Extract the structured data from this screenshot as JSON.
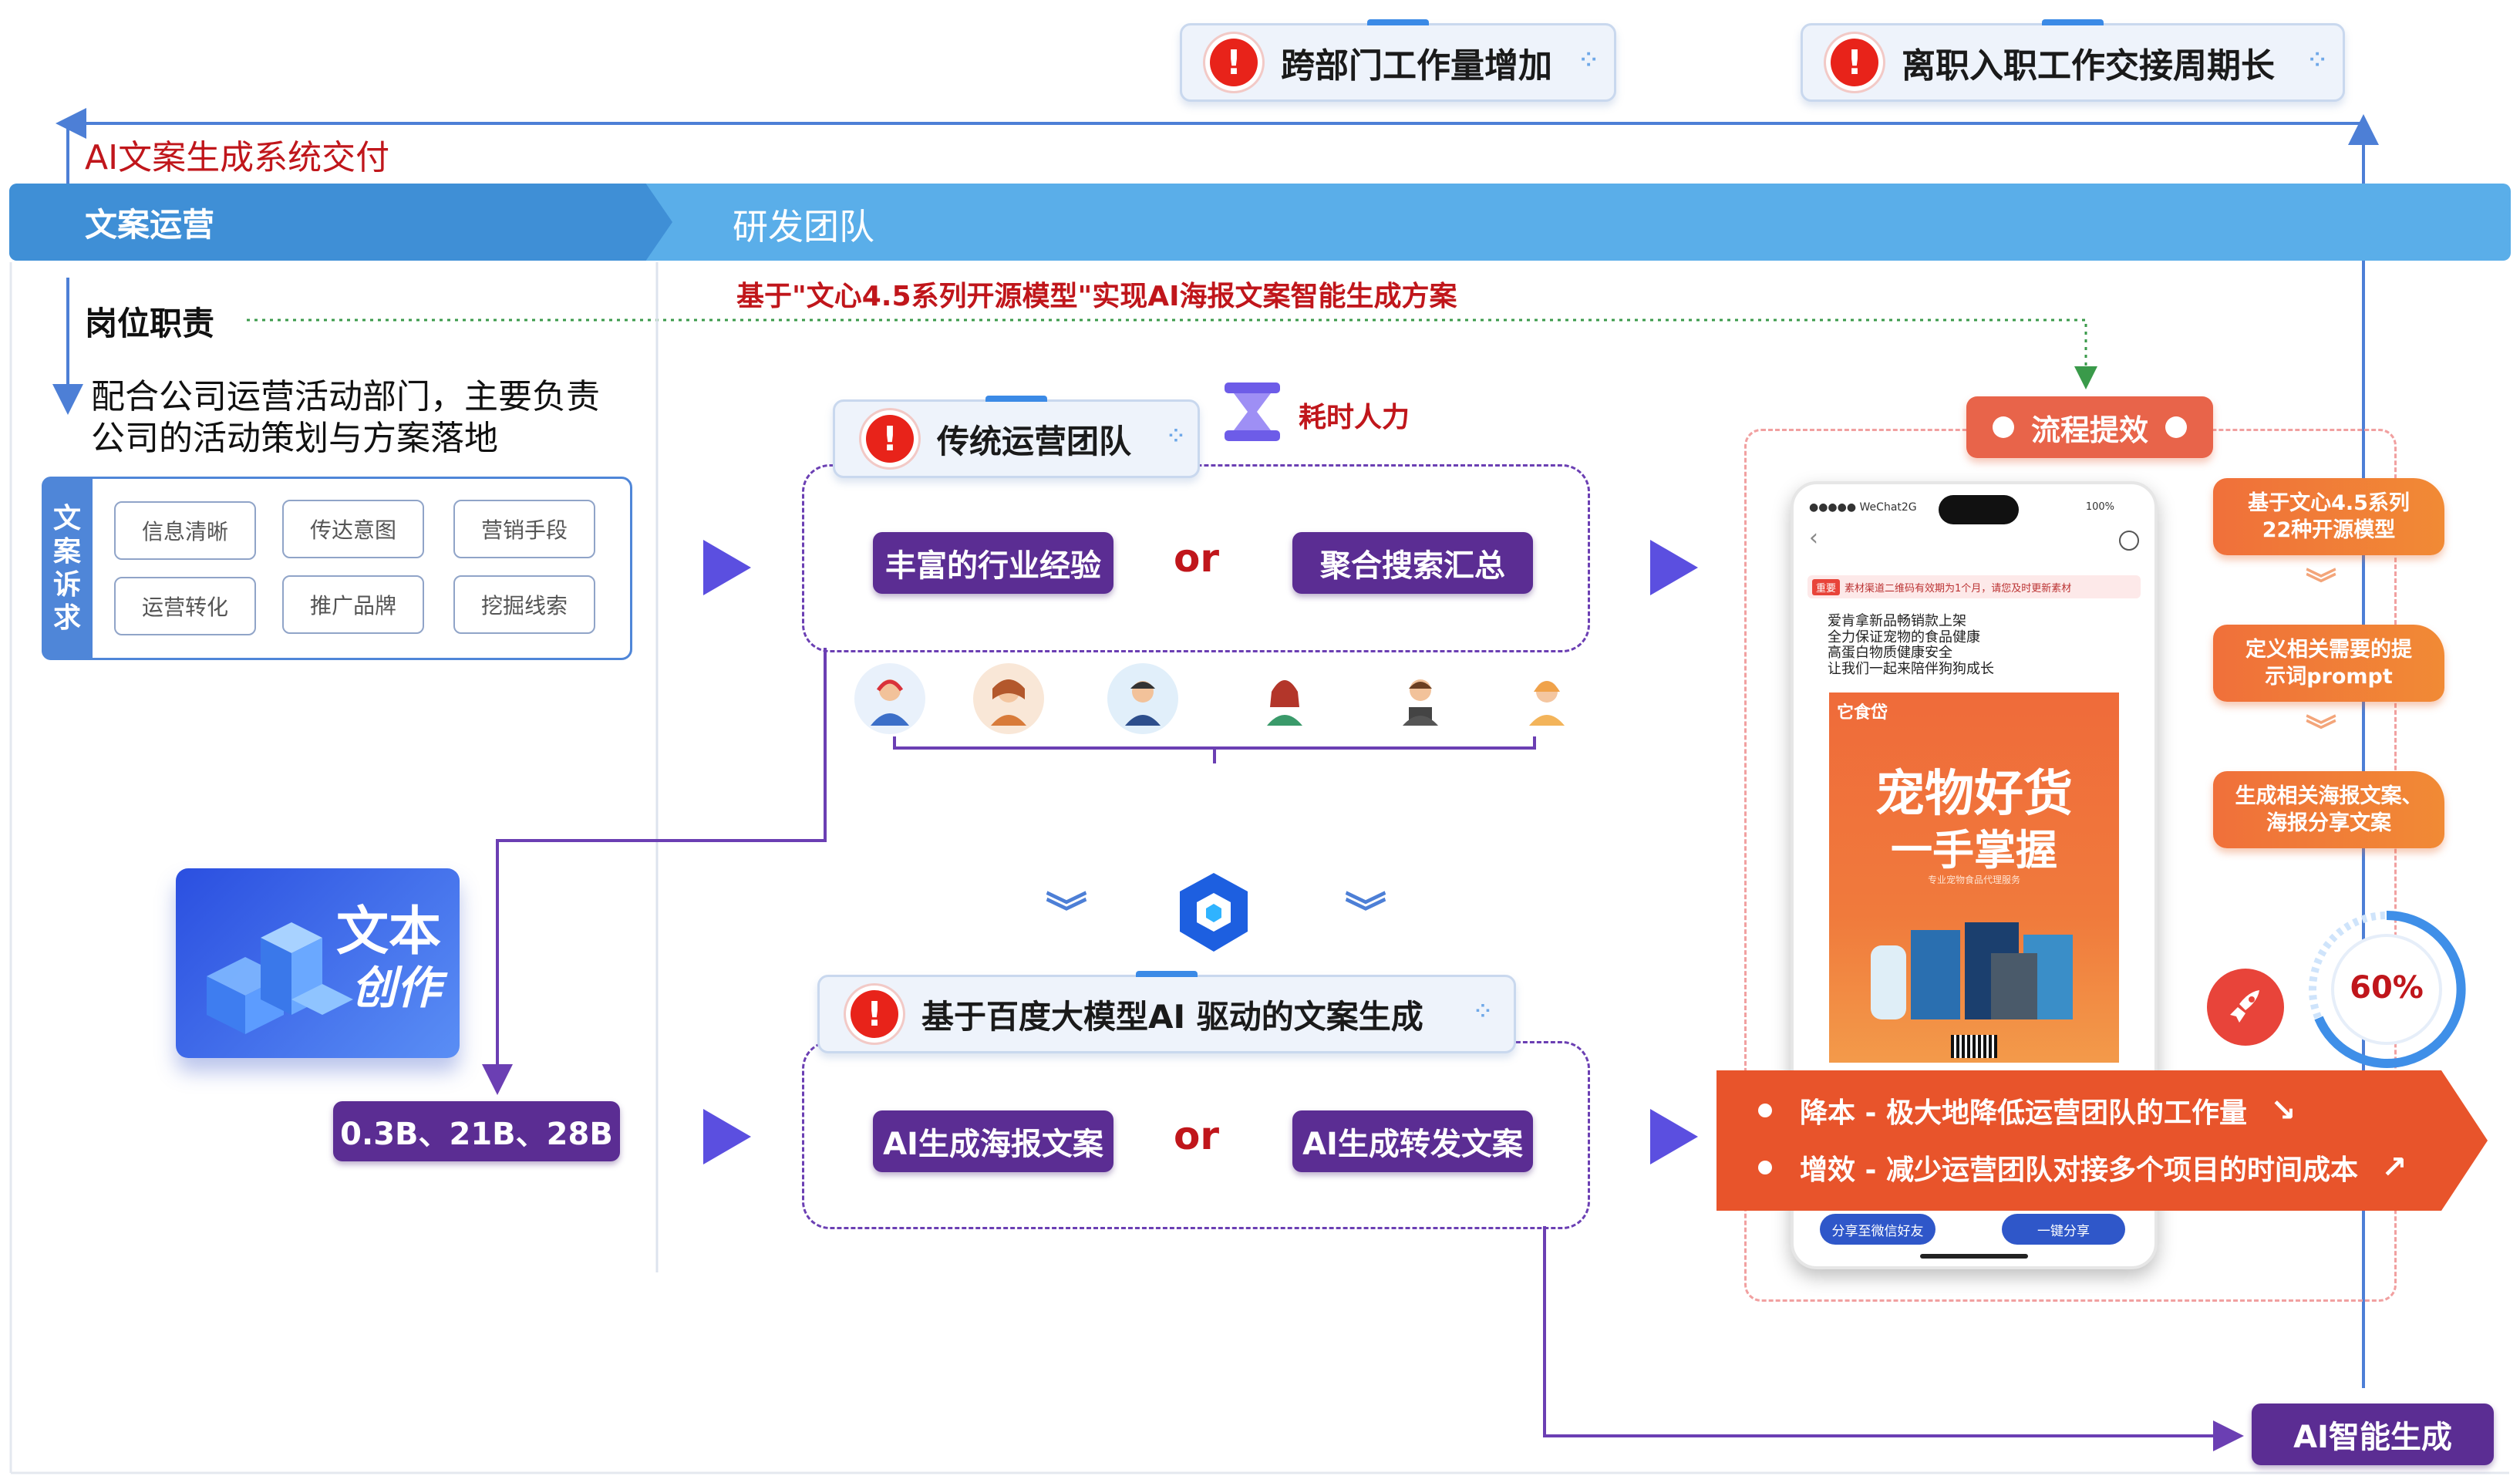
{
  "alerts_top": [
    "跨部门工作量增加",
    "离职入职工作交接周期长"
  ],
  "delivery_label": "AI文案生成系统交付",
  "header": {
    "left": "文案运营",
    "right": "研发团队"
  },
  "solution_title": "基于\"文心4.5系列开源模型\"实现AI海报文案智能生成方案",
  "duty": {
    "title": "岗位职责",
    "desc_line1": "配合公司运营活动部门，主要负责",
    "desc_line2": "公司的活动策划与方案落地"
  },
  "demands": {
    "side_label": [
      "文",
      "案",
      "诉",
      "求"
    ],
    "tags": [
      "信息清晰",
      "传达意图",
      "营销手段",
      "运营转化",
      "推广品牌",
      "挖掘线索"
    ]
  },
  "traditional": {
    "title": "传统运营团队",
    "cost_label": "耗时人力",
    "option_a": "丰富的行业经验",
    "or": "or",
    "option_b": "聚合搜索汇总"
  },
  "ai_flow": {
    "title": "基于百度大模型AI 驱动的文案生成",
    "option_a": "AI生成海报文案",
    "or": "or",
    "option_b": "AI生成转发文案"
  },
  "text_creation": {
    "line1": "文本",
    "line2": "创作"
  },
  "model_sizes": "0.3B、21B、28B",
  "efficiency": {
    "title": "流程提效",
    "steps": [
      "基于文心4.5系列\n22种开源模型",
      "定义相关需要的提\n示词prompt",
      "生成相关海报文案、\n海报分享文案"
    ],
    "gauge": "60%"
  },
  "phone": {
    "carrier": "●●●●● WeChat2G",
    "battery": "100%",
    "notice_tag": "重要",
    "notice": "素材渠道二维码有效期为1个月，请您及时更新素材",
    "bullets": [
      "爱肯拿新品畅销款上架",
      "全力保证宠物的食品健康",
      "高蛋白物质健康安全",
      "让我们一起来陪伴狗狗成长"
    ],
    "brand": "它食岱",
    "poster_line1": "宠物好货",
    "poster_line2": "一手掌握",
    "poster_sub": "专业宠物食品代理服务",
    "share_friend": "分享至微信好友",
    "share_one": "一键分享"
  },
  "benefits": [
    "降本 - 极大地降低运营团队的工作量",
    "增效 - 减少运营团队对接多个项目的时间成本"
  ],
  "ai_result": "AI智能生成",
  "colors": {
    "header_blue": "#5aaee9",
    "purple": "#5b2d93",
    "red_text": "#c0161b",
    "orange": "#e8542b",
    "arrow_blue": "#5b4fe0"
  }
}
